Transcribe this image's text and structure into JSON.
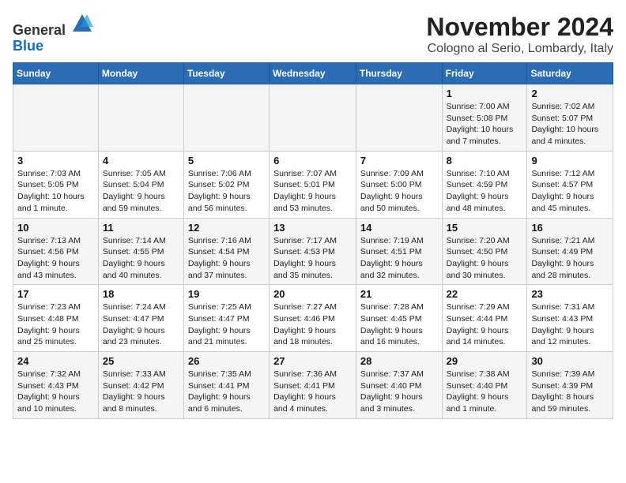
{
  "logo": {
    "general": "General",
    "blue": "Blue"
  },
  "title": "November 2024",
  "location": "Cologno al Serio, Lombardy, Italy",
  "days_of_week": [
    "Sunday",
    "Monday",
    "Tuesday",
    "Wednesday",
    "Thursday",
    "Friday",
    "Saturday"
  ],
  "weeks": [
    [
      {
        "date": "",
        "info": ""
      },
      {
        "date": "",
        "info": ""
      },
      {
        "date": "",
        "info": ""
      },
      {
        "date": "",
        "info": ""
      },
      {
        "date": "",
        "info": ""
      },
      {
        "date": "1",
        "info": "Sunrise: 7:00 AM\nSunset: 5:08 PM\nDaylight: 10 hours and 7 minutes."
      },
      {
        "date": "2",
        "info": "Sunrise: 7:02 AM\nSunset: 5:07 PM\nDaylight: 10 hours and 4 minutes."
      }
    ],
    [
      {
        "date": "3",
        "info": "Sunrise: 7:03 AM\nSunset: 5:05 PM\nDaylight: 10 hours and 1 minute."
      },
      {
        "date": "4",
        "info": "Sunrise: 7:05 AM\nSunset: 5:04 PM\nDaylight: 9 hours and 59 minutes."
      },
      {
        "date": "5",
        "info": "Sunrise: 7:06 AM\nSunset: 5:02 PM\nDaylight: 9 hours and 56 minutes."
      },
      {
        "date": "6",
        "info": "Sunrise: 7:07 AM\nSunset: 5:01 PM\nDaylight: 9 hours and 53 minutes."
      },
      {
        "date": "7",
        "info": "Sunrise: 7:09 AM\nSunset: 5:00 PM\nDaylight: 9 hours and 50 minutes."
      },
      {
        "date": "8",
        "info": "Sunrise: 7:10 AM\nSunset: 4:59 PM\nDaylight: 9 hours and 48 minutes."
      },
      {
        "date": "9",
        "info": "Sunrise: 7:12 AM\nSunset: 4:57 PM\nDaylight: 9 hours and 45 minutes."
      }
    ],
    [
      {
        "date": "10",
        "info": "Sunrise: 7:13 AM\nSunset: 4:56 PM\nDaylight: 9 hours and 43 minutes."
      },
      {
        "date": "11",
        "info": "Sunrise: 7:14 AM\nSunset: 4:55 PM\nDaylight: 9 hours and 40 minutes."
      },
      {
        "date": "12",
        "info": "Sunrise: 7:16 AM\nSunset: 4:54 PM\nDaylight: 9 hours and 37 minutes."
      },
      {
        "date": "13",
        "info": "Sunrise: 7:17 AM\nSunset: 4:53 PM\nDaylight: 9 hours and 35 minutes."
      },
      {
        "date": "14",
        "info": "Sunrise: 7:19 AM\nSunset: 4:51 PM\nDaylight: 9 hours and 32 minutes."
      },
      {
        "date": "15",
        "info": "Sunrise: 7:20 AM\nSunset: 4:50 PM\nDaylight: 9 hours and 30 minutes."
      },
      {
        "date": "16",
        "info": "Sunrise: 7:21 AM\nSunset: 4:49 PM\nDaylight: 9 hours and 28 minutes."
      }
    ],
    [
      {
        "date": "17",
        "info": "Sunrise: 7:23 AM\nSunset: 4:48 PM\nDaylight: 9 hours and 25 minutes."
      },
      {
        "date": "18",
        "info": "Sunrise: 7:24 AM\nSunset: 4:47 PM\nDaylight: 9 hours and 23 minutes."
      },
      {
        "date": "19",
        "info": "Sunrise: 7:25 AM\nSunset: 4:47 PM\nDaylight: 9 hours and 21 minutes."
      },
      {
        "date": "20",
        "info": "Sunrise: 7:27 AM\nSunset: 4:46 PM\nDaylight: 9 hours and 18 minutes."
      },
      {
        "date": "21",
        "info": "Sunrise: 7:28 AM\nSunset: 4:45 PM\nDaylight: 9 hours and 16 minutes."
      },
      {
        "date": "22",
        "info": "Sunrise: 7:29 AM\nSunset: 4:44 PM\nDaylight: 9 hours and 14 minutes."
      },
      {
        "date": "23",
        "info": "Sunrise: 7:31 AM\nSunset: 4:43 PM\nDaylight: 9 hours and 12 minutes."
      }
    ],
    [
      {
        "date": "24",
        "info": "Sunrise: 7:32 AM\nSunset: 4:43 PM\nDaylight: 9 hours and 10 minutes."
      },
      {
        "date": "25",
        "info": "Sunrise: 7:33 AM\nSunset: 4:42 PM\nDaylight: 9 hours and 8 minutes."
      },
      {
        "date": "26",
        "info": "Sunrise: 7:35 AM\nSunset: 4:41 PM\nDaylight: 9 hours and 6 minutes."
      },
      {
        "date": "27",
        "info": "Sunrise: 7:36 AM\nSunset: 4:41 PM\nDaylight: 9 hours and 4 minutes."
      },
      {
        "date": "28",
        "info": "Sunrise: 7:37 AM\nSunset: 4:40 PM\nDaylight: 9 hours and 3 minutes."
      },
      {
        "date": "29",
        "info": "Sunrise: 7:38 AM\nSunset: 4:40 PM\nDaylight: 9 hours and 1 minute."
      },
      {
        "date": "30",
        "info": "Sunrise: 7:39 AM\nSunset: 4:39 PM\nDaylight: 8 hours and 59 minutes."
      }
    ]
  ]
}
